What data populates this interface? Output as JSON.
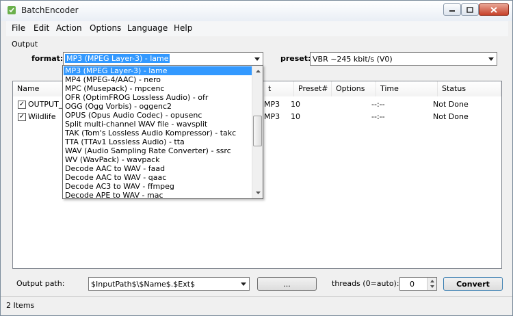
{
  "window": {
    "title": "BatchEncoder"
  },
  "menu": [
    "File",
    "Edit",
    "Action",
    "Options",
    "Language",
    "Help"
  ],
  "output_group": {
    "label": "Output"
  },
  "format": {
    "label": "format:",
    "value": "MP3 (MPEG Layer-3) - lame",
    "options": [
      "MP3 (MPEG Layer-3) - lame",
      "MP4 (MPEG-4/AAC) - nero",
      "MPC (Musepack) - mpcenc",
      "OFR (OptimFROG Lossless Audio) - ofr",
      "OGG (Ogg Vorbis) - oggenc2",
      "OPUS (Opus Audio Codec) - opusenc",
      "Split multi-channel WAV file - wavsplit",
      "TAK (Tom's Lossless Audio Kompressor) - takc",
      "TTA (TTAv1 Lossless Audio) - tta",
      "WAV (Audio Sampling Rate Converter) - ssrc",
      "WV (WavPack) - wavpack",
      "Decode AAC to WAV - faad",
      "Decode AAC to WAV - qaac",
      "Decode AC3 to WAV - ffmpeg",
      "Decode APE to WAV - mac"
    ]
  },
  "preset": {
    "label": "preset:",
    "value": "VBR ~245 kbit/s (V0)"
  },
  "table": {
    "headers": [
      "Name",
      "t",
      "Preset#",
      "Options",
      "Time",
      "Status"
    ],
    "rows": [
      {
        "name": "OUTPUT_V",
        "type": "MP3",
        "preset": "10",
        "options": "",
        "time": "--:--",
        "status": "Not Done",
        "checked": "✓"
      },
      {
        "name": "Wildlife",
        "type": "MP3",
        "preset": "10",
        "options": "",
        "time": "--:--",
        "status": "Not Done",
        "checked": "✓"
      }
    ]
  },
  "output_path": {
    "label": "Output path:",
    "value": "$InputPath$\\$Name$.$Ext$",
    "browse_label": "..."
  },
  "threads": {
    "label": "threads (0=auto):",
    "value": "0"
  },
  "convert_label": "Convert",
  "status_bar": {
    "text": "2 Items"
  },
  "colors": {
    "selection": "#3399ff",
    "close": "#c7412a"
  }
}
